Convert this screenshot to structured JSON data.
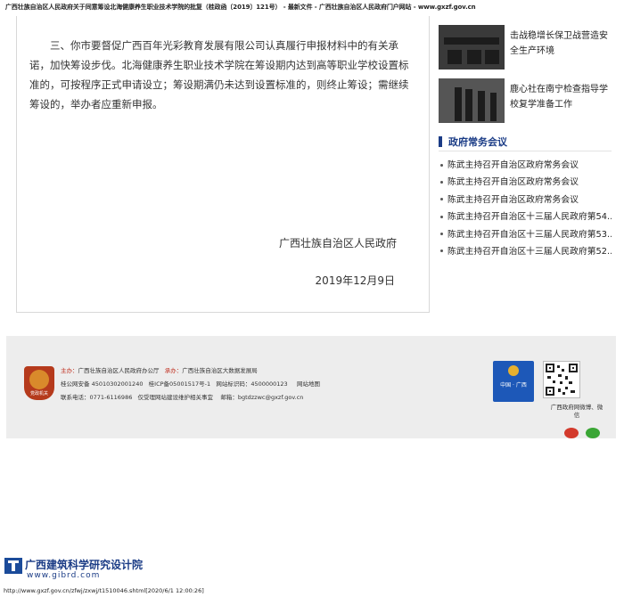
{
  "page_header": {
    "title": "广西壮族自治区人民政府关于同意筹设北海健康养生职业技术学院的批复（桂政函〔2019〕121号） - 最新文件 - 广西壮族自治区人民政府门户网站 - www.gxzf.gov.cn"
  },
  "article": {
    "paragraph_1": "三、你市要督促广西百年光彩教育发展有限公司认真履行申报材料中的有关承诺，加快筹设步伐。北海健康养生职业技术学院在筹设期内达到高等职业学校设置标准的，可按程序正式申请设立；筹设期满仍未达到设置标准的，则终止筹设；需继续筹设的，举办者应重新申报。",
    "signature": "广西壮族自治区人民政府",
    "date": "2019年12月9日"
  },
  "sidebar": {
    "news": [
      {
        "text": "击战稳增长保卫战营造安全生产环境"
      },
      {
        "text": "鹿心社在南宁检查指导学校复学准备工作"
      }
    ],
    "section_title": "政府常务会议",
    "meetings": [
      "陈武主持召开自治区政府常务会议",
      "陈武主持召开自治区政府常务会议",
      "陈武主持召开自治区政府常务会议",
      "陈武主持召开自治区十三届人民政府第54...",
      "陈武主持召开自治区十三届人民政府第53...",
      "陈武主持召开自治区十三届人民政府第52..."
    ]
  },
  "footer": {
    "emblem_text": "党政机关",
    "sponsor_label": "主办：",
    "sponsor": "广西壮族自治区人民政府办公厅",
    "organizer_label": "承办：",
    "organizer": "广西壮族自治区大数据发展局",
    "police_record": "桂公网安备 45010302001240",
    "icp": "桂ICP备05001517号-1",
    "site_id": "网站标识码：4500000123",
    "sitemap": "网站地图",
    "contact": "联系电话：0771-6116986",
    "contact_note": "仅受理网站建设维护相关事宜",
    "email": "邮箱：bgtdzzwc@gxzf.gov.cn",
    "badge_text": "中国 · 广西",
    "weibo_label": "广西政府网微博、微信"
  },
  "watermark": {
    "org_name": "广西建筑科学研究设计院",
    "org_url": "www.gibrd.com"
  },
  "bottom_url": "http://www.gxzf.gov.cn/zfwj/zxwj/t1510046.shtml[2020/6/1 12:00:26]",
  "colors": {
    "accent": "#1b3c86",
    "footer_bg": "#ededed",
    "emblem": "#b53a1c",
    "badge": "#1d58b8"
  }
}
